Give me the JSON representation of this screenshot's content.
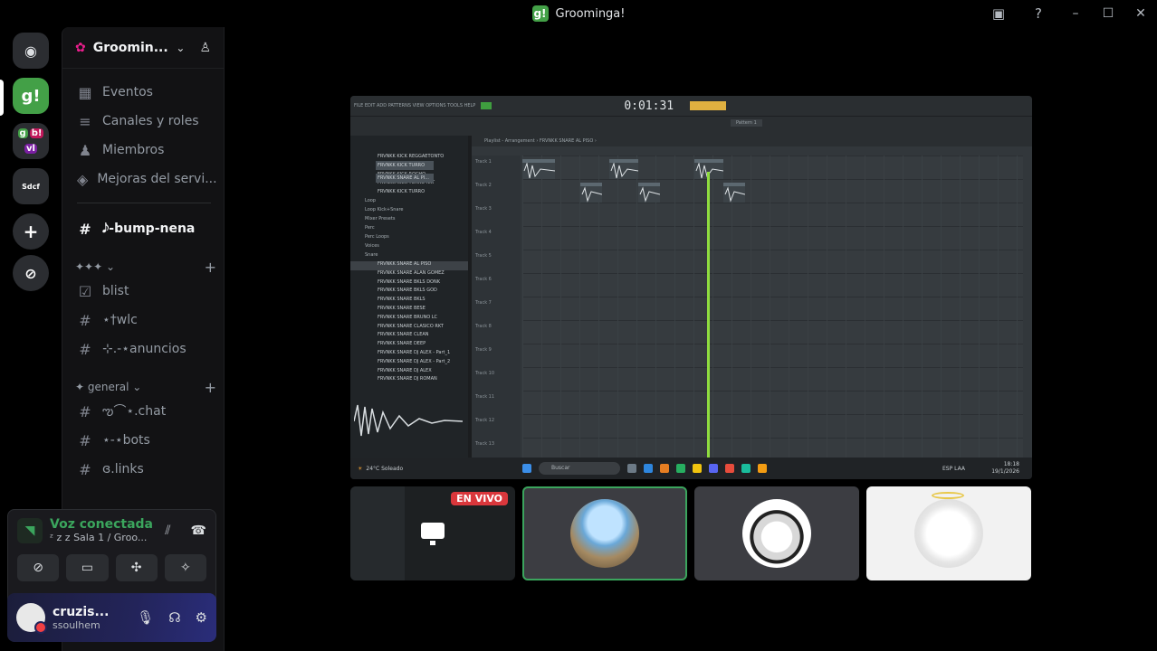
{
  "window": {
    "title": "Groominga!",
    "app_icon": "g!",
    "controls": [
      "–",
      "☐",
      "✕"
    ]
  },
  "top_icons": [
    "inbox-icon",
    "help-icon"
  ],
  "servers": [
    {
      "name": "discord-home",
      "glyph": "◉",
      "color": "#2b2d31"
    },
    {
      "name": "groominga",
      "glyph": "g!",
      "color": "#43a047",
      "selected": true
    },
    {
      "name": "folder-gb-vl",
      "glyph": "g b vl",
      "color": "#2b2d31"
    },
    {
      "name": "folder-sdcf",
      "glyph": "Sdcf",
      "color": "#2b2d31"
    },
    {
      "name": "add-server",
      "glyph": "+",
      "color": "#2b2d31"
    },
    {
      "name": "discover",
      "glyph": "⊘",
      "color": "#2b2d31"
    }
  ],
  "sidebar": {
    "server_name": "Groomin...",
    "top_items": [
      {
        "icon": "calendar-icon",
        "glyph": "▦",
        "label": "Eventos"
      },
      {
        "icon": "channels-roles-icon",
        "glyph": "≡",
        "label": "Canales y roles"
      },
      {
        "icon": "members-icon",
        "glyph": "♟",
        "label": "Miembros"
      },
      {
        "icon": "boost-icon",
        "glyph": "◈",
        "label": "Mejoras del servi..."
      }
    ],
    "active_channel": "𝅘𝅥𝅮-bump-nena",
    "categories": [
      {
        "label": "✦✦✦ ⌄",
        "channels": [
          {
            "glyph": "☑",
            "label": "blist"
          },
          {
            "glyph": "#",
            "label": "⋆†wlc"
          },
          {
            "glyph": "#",
            "label": "⊹.-⋆anuncios"
          }
        ]
      },
      {
        "label": "✦ general ⌄",
        "channels": [
          {
            "glyph": "#",
            "label": "ఌ⌒⋆.chat"
          },
          {
            "glyph": "#",
            "label": "⋆-⋆bots"
          },
          {
            "glyph": "#",
            "label": "ɞ.links"
          }
        ]
      }
    ]
  },
  "voice": {
    "status": "Voz conectada",
    "room": "ᶻ z 𝗓 Sala 1 / Groo..."
  },
  "user": {
    "name": "cruzis...",
    "handle": "ssoulhem"
  },
  "stream": {
    "fl_menu": "FILE EDIT ADD PATTERNS VIEW OPTIONS TOOLS HELP",
    "fl_time": "0:01:31",
    "playlist_title": "Playlist - Arrangement › FRVNKK SNARE AL PISO ›",
    "pattern": "Pattern 1",
    "browser_folders": [
      "Loop",
      "Loop Kick+Snare",
      "Mixer Presets",
      "Perc",
      "Perc Loops",
      "Voices",
      "Snare"
    ],
    "browser_items_top": [
      "FRVNKK KICK REGGAETONTO",
      "FRVNKK KICK RKT",
      "FRVNKK KICK ROCHO",
      "FRVNKK KICK TURRO RKT",
      "FRVNKK KICK TURRO"
    ],
    "browser_items_snare": [
      "FRVNKK SNARE AL PISO",
      "FRVNKK SNARE ALAN GOMEZ",
      "FRVNKK SNARE BKLS DONK",
      "FRVNKK SNARE BKLS GOD",
      "FRVNKK SNARE BKLS",
      "FRVNKK SNARE BESE",
      "FRVNKK SNARE BRUNO LC",
      "FRVNKK SNARE CLASICO RKT",
      "FRVNKK SNARE CLEAN",
      "FRVNKK SNARE DEEP",
      "FRVNKK SNARE DJ ALEX - Part_1",
      "FRVNKK SNARE DJ ALEX - Part_2",
      "FRVNKK SNARE DJ ALEX",
      "FRVNKK SNARE DJ ROMAN"
    ],
    "channel_rack": [
      "FRVNKK KICK TURRO",
      "FRVNKK SNARE AL PI..."
    ],
    "tracks": [
      "Track 1",
      "Track 2",
      "Track 3",
      "Track 4",
      "Track 5",
      "Track 6",
      "Track 7",
      "Track 8",
      "Track 9",
      "Track 10",
      "Track 11",
      "Track 12",
      "Track 13"
    ],
    "taskbar_weather": "24°C Soleado",
    "taskbar_search": "Buscar",
    "taskbar_time": "18:18",
    "taskbar_date": "19/1/2026",
    "taskbar_lang": "ESP LAA"
  },
  "tiles": [
    {
      "kind": "screen",
      "badge": "EN VIVO"
    },
    {
      "kind": "avatar",
      "talking": true
    },
    {
      "kind": "avatar"
    },
    {
      "kind": "avatar"
    }
  ]
}
